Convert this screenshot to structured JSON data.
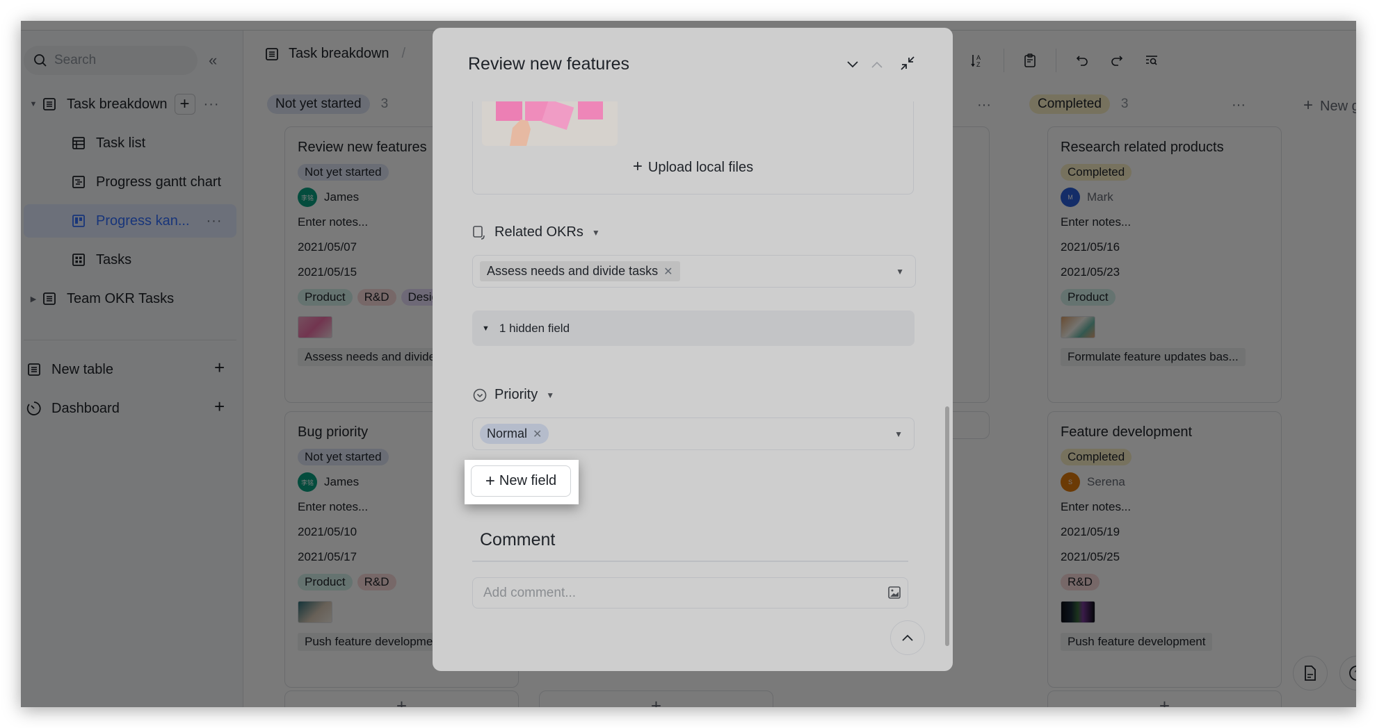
{
  "sidebar": {
    "search_placeholder": "Search",
    "collapse_icon": "double-chevron-left-icon",
    "tree": [
      {
        "label": "Task breakdown",
        "icon": "table-icon",
        "level": 0,
        "expanded": true
      },
      {
        "label": "Task list",
        "icon": "grid-view-icon",
        "level": 1
      },
      {
        "label": "Progress gantt chart",
        "icon": "gantt-icon",
        "level": 1
      },
      {
        "label": "Progress kan...",
        "icon": "kanban-icon",
        "level": 1,
        "active": true
      },
      {
        "label": "Tasks",
        "icon": "gallery-icon",
        "level": 1
      },
      {
        "label": "Team OKR Tasks",
        "icon": "table-icon",
        "level": 0,
        "expanded": false
      }
    ],
    "new_table_label": "New table",
    "dashboard_label": "Dashboard"
  },
  "main": {
    "breadcrumb": [
      "Task breakdown"
    ],
    "toolbar_icons": [
      "sort-icon",
      "checklist-icon",
      "undo-icon",
      "redo-icon",
      "search-filter-icon"
    ],
    "columns": [
      {
        "name": "Not yet started",
        "count": "3",
        "pill_color": "#dee4f5",
        "cards": [
          {
            "title": "Review new features",
            "status": "Not yet started",
            "assignee": "James",
            "assignee_initials": "李铭",
            "assignee_color": "#0aa07f",
            "notes": "Enter notes...",
            "start": "2021/05/07",
            "end": "2021/05/15",
            "tags": [
              "Product",
              "R&D",
              "Design"
            ],
            "link": "Assess needs and divide t..."
          },
          {
            "title": "Bug priority",
            "status": "Not yet started",
            "assignee": "James",
            "assignee_initials": "李铭",
            "assignee_color": "#0aa07f",
            "notes": "Enter notes...",
            "start": "2021/05/10",
            "end": "2021/05/17",
            "tags": [
              "Product",
              "R&D"
            ],
            "link": "Push feature development"
          }
        ]
      },
      {
        "name": "Completed",
        "count": "3",
        "pill_color": "#f8eec5",
        "cards": [
          {
            "title": "Research related products",
            "status": "Completed",
            "assignee": "Mark",
            "assignee_initials": "M",
            "assignee_color": "#2b5fd9",
            "notes": "Enter notes...",
            "start": "2021/05/16",
            "end": "2021/05/23",
            "tags": [
              "Product"
            ],
            "link": "Formulate feature updates bas..."
          },
          {
            "title": "Feature development",
            "status": "Completed",
            "assignee": "Serena",
            "assignee_initials": "S",
            "assignee_color": "#e07a0b",
            "notes": "Enter notes...",
            "start": "2021/05/19",
            "end": "2021/05/25",
            "tags": [
              "R&D"
            ],
            "link": "Push feature development"
          }
        ]
      }
    ],
    "hidden_column_link_fragment": "n",
    "new_group_label": "New gro",
    "add_card_label": "+"
  },
  "tag_colors": {
    "Product": "#d4f0ea",
    "R&D": "#f9d9d9",
    "Design": "#e6dcf8"
  },
  "modal": {
    "title": "Review new features",
    "controls": [
      "chevron-down-icon",
      "chevron-up-icon",
      "collapse-icon"
    ],
    "upload_label": "Upload local files",
    "related_okrs": {
      "label": "Related OKRs",
      "value": "Assess needs and divide tasks"
    },
    "hidden_field_label": "1 hidden field",
    "priority": {
      "label": "Priority",
      "value": "Normal"
    },
    "new_field_label": "New field",
    "comment": {
      "title": "Comment",
      "placeholder": "Add comment..."
    }
  }
}
